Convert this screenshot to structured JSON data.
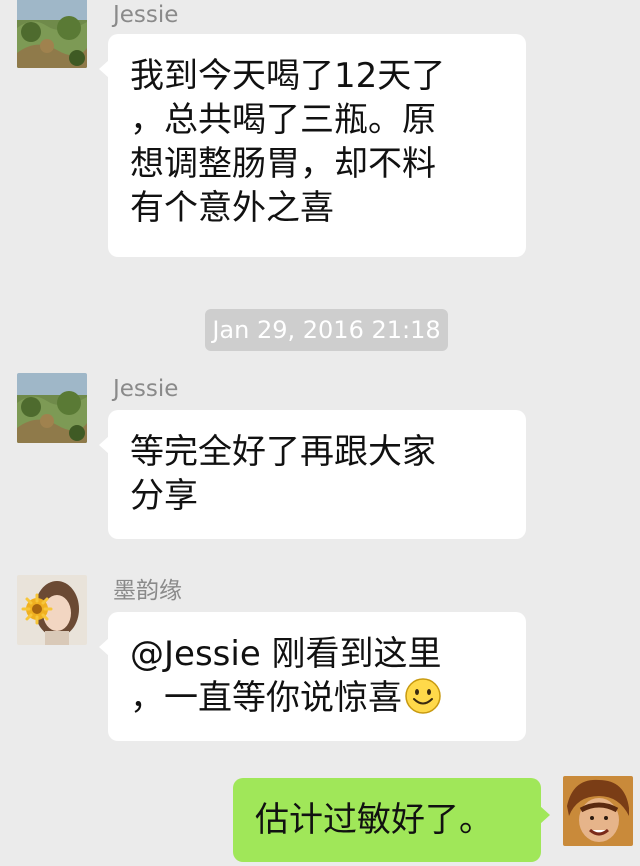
{
  "messages": [
    {
      "sender": "Jessie",
      "lines": [
        "我到今天喝了12天了",
        "，总共喝了三瓶。原",
        "想调整肠胃，却不料",
        "有个意外之喜"
      ]
    },
    {
      "sender": "Jessie",
      "lines": [
        "等完全好了再跟大家",
        "分享"
      ]
    },
    {
      "sender": "墨韵缘",
      "lines": [
        "@Jessie 刚看到这里",
        "，一直等你说惊喜"
      ],
      "emoji": "smile-emoji"
    },
    {
      "sender": "",
      "lines": [
        "估计过敏好了。"
      ]
    }
  ],
  "timestamp": "Jan 29, 2016 21:18",
  "colors": {
    "background": "#ebebeb",
    "incoming_bubble": "#ffffff",
    "outgoing_bubble": "#a0e759",
    "timestamp_pill": "#cecece",
    "sender_name": "#8a8a8a"
  },
  "icons": [
    "garden-avatar",
    "flower-girl-avatar",
    "self-avatar",
    "smile-emoji"
  ]
}
